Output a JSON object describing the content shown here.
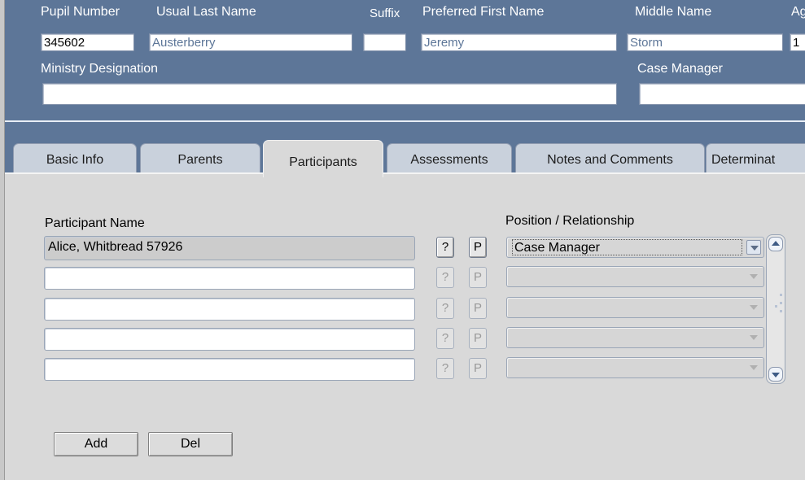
{
  "header": {
    "labels": {
      "pupil_number": "Pupil Number",
      "usual_last_name": "Usual Last Name",
      "suffix": "Suffix",
      "preferred_first_name": "Preferred First Name",
      "middle_name": "Middle Name",
      "age_partial": "Ag",
      "ministry_designation": "Ministry Designation",
      "case_manager": "Case Manager"
    },
    "values": {
      "pupil_number": "345602",
      "usual_last_name": "Austerberry",
      "suffix": "",
      "preferred_first_name": "Jeremy",
      "middle_name": "Storm",
      "age_partial": "1",
      "ministry_designation": "",
      "case_manager": ""
    }
  },
  "tabs": [
    {
      "label": "Basic Info",
      "active": false
    },
    {
      "label": "Parents",
      "active": false
    },
    {
      "label": "Participants",
      "active": true
    },
    {
      "label": "Assessments",
      "active": false
    },
    {
      "label": "Notes and Comments",
      "active": false
    },
    {
      "label": "Determinat",
      "active": false
    }
  ],
  "participants": {
    "name_header": "Participant Name",
    "position_header": "Position / Relationship",
    "rows": [
      {
        "name": "Alice, Whitbread 57926",
        "position": "Case Manager",
        "q_label": "?",
        "p_label": "P",
        "enabled": true
      },
      {
        "name": "",
        "position": "",
        "q_label": "?",
        "p_label": "P",
        "enabled": false
      },
      {
        "name": "",
        "position": "",
        "q_label": "?",
        "p_label": "P",
        "enabled": false
      },
      {
        "name": "",
        "position": "",
        "q_label": "?",
        "p_label": "P",
        "enabled": false
      },
      {
        "name": "",
        "position": "",
        "q_label": "?",
        "p_label": "P",
        "enabled": false
      }
    ]
  },
  "buttons": {
    "add": "Add",
    "del": "Del"
  },
  "icons": {
    "dropdown": "chevron-down-icon",
    "scroll_up": "scroll-up-icon",
    "scroll_down": "scroll-down-icon"
  },
  "colors": {
    "header_bg": "#5d7698",
    "panel_bg": "#d9d9d9",
    "tab_bg": "#c9d1dc"
  }
}
